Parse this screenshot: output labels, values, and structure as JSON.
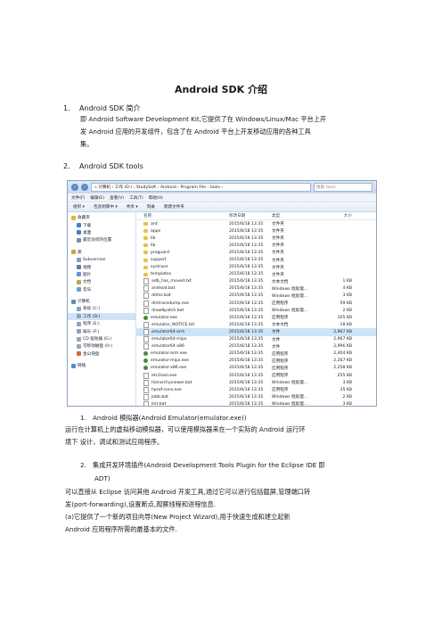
{
  "doc": {
    "title": "Android SDK 介绍",
    "s1_num": "1.",
    "s1_title": "Android SDK 简介",
    "s1_line1": "即 Android Software Development Kit,它提供了在 Windows/Linux/Mac 平台上开",
    "s1_line2": "发 Android 应用的开发组件，包含了在 Android 平台上开发移动应用的各种工具",
    "s1_line3": "集。",
    "s2_num": "2.",
    "s2_title": "Android SDK tools",
    "sub1_num": "1.",
    "sub1_title": "Android 模拟器(Android Emulator(emulator.exe))",
    "p1_line1": "运行在计算机上的虚拟移动模拟器，可以使用模拟器来在一个实际的 Android 运行环",
    "p1_line2": "境下 设计，调试和测试应用程序。",
    "sub2_num": "2.",
    "sub2_title": "集成开发环境插件(Android Development Tools Plugin for the Eclipse IDE  即",
    "sub2_title2": "ADT)",
    "p2_line1": "可以直接从 Eclipse 访问其他 Android 开发工具,通过它可以进行包括截屏,管理端口转",
    "p2_line2": "发(port-forwarding),设置断点,观察线程和进程信息.",
    "p2_line3": "(a)它提供了一个新的项目向导(New Project Wizard),用于快速生成和建立起新",
    "p2_line4": "Android 应用程序所需的最基本的文件."
  },
  "explorer": {
    "address": "« 计算机 › 工作 (D:) › StudySoft › Android › Program File › tools ›",
    "search_placeholder": "搜索 tools",
    "menu": [
      "文件(F)",
      "编辑(E)",
      "查看(V)",
      "工具(T)",
      "帮助(H)"
    ],
    "toolbar": [
      "组织 ▾",
      "包含到库中 ▾",
      "共享 ▾",
      "刻录",
      "新建文件夹"
    ],
    "nav": [
      {
        "label": "收藏夹",
        "child": false,
        "color": "#e2b33a"
      },
      {
        "label": "下载",
        "child": true,
        "color": "#4a7fc1"
      },
      {
        "label": "桌面",
        "child": true,
        "color": "#4a7fc1"
      },
      {
        "label": "最近访问的位置",
        "child": true,
        "color": "#7a8fa8"
      },
      {
        "gap": true
      },
      {
        "label": "库",
        "child": false,
        "color": "#c8a24a"
      },
      {
        "label": "Subversion",
        "child": true,
        "color": "#8b9bb0"
      },
      {
        "label": "视频",
        "child": true,
        "color": "#5b7fb0"
      },
      {
        "label": "图片",
        "child": true,
        "color": "#5b9ad0"
      },
      {
        "label": "文档",
        "child": true,
        "color": "#c8a24a"
      },
      {
        "label": "音乐",
        "child": true,
        "color": "#6aa0d8"
      },
      {
        "gap": true
      },
      {
        "label": "计算机",
        "child": false,
        "color": "#6c8bb0"
      },
      {
        "label": "系统 (C:)",
        "child": true,
        "color": "#8da3be"
      },
      {
        "label": "工作 (D:)",
        "child": true,
        "color": "#8da3be",
        "selected": true
      },
      {
        "label": "程序 (E:)",
        "child": true,
        "color": "#8da3be"
      },
      {
        "label": "娱乐 (F:)",
        "child": true,
        "color": "#8da3be"
      },
      {
        "label": "CD 驱动器 (G:)",
        "child": true,
        "color": "#9aa6b4"
      },
      {
        "label": "可移动磁盘 (H:)",
        "child": true,
        "color": "#9aa6b4"
      },
      {
        "label": "金山快盘",
        "child": true,
        "color": "#d06a3a"
      },
      {
        "gap": true
      },
      {
        "label": "网络",
        "child": false,
        "color": "#5a8bc8"
      }
    ],
    "headers": {
      "name": "名称",
      "date": "修改日期",
      "type": "类型",
      "size": "大小"
    },
    "files": [
      {
        "name": "ant",
        "date": "2015/6/18 13:35",
        "type": "文件夹",
        "size": "",
        "icon": "folder"
      },
      {
        "name": "apps",
        "date": "2015/6/18 13:35",
        "type": "文件夹",
        "size": "",
        "icon": "folder"
      },
      {
        "name": "lib",
        "date": "2015/6/18 13:35",
        "type": "文件夹",
        "size": "",
        "icon": "folder"
      },
      {
        "name": "lib",
        "date": "2015/6/18 13:35",
        "type": "文件夹",
        "size": "",
        "icon": "folder"
      },
      {
        "name": "proguard",
        "date": "2015/6/18 13:35",
        "type": "文件夹",
        "size": "",
        "icon": "folder"
      },
      {
        "name": "support",
        "date": "2015/6/18 13:35",
        "type": "文件夹",
        "size": "",
        "icon": "folder"
      },
      {
        "name": "systrace",
        "date": "2015/6/18 13:35",
        "type": "文件夹",
        "size": "",
        "icon": "folder"
      },
      {
        "name": "templates",
        "date": "2015/6/18 13:35",
        "type": "文件夹",
        "size": "",
        "icon": "folder"
      },
      {
        "name": "adb_has_moved.txt",
        "date": "2015/6/18 13:35",
        "type": "文本文档",
        "size": "1 KB",
        "icon": "file"
      },
      {
        "name": "android.bat",
        "date": "2015/6/18 13:35",
        "type": "Windows 批处理...",
        "size": "4 KB",
        "icon": "file"
      },
      {
        "name": "ddms.bat",
        "date": "2015/6/18 13:35",
        "type": "Windows 批处理...",
        "size": "3 KB",
        "icon": "file"
      },
      {
        "name": "dmtracedump.exe",
        "date": "2015/6/18 13:35",
        "type": "应用程序",
        "size": "59 KB",
        "icon": "file"
      },
      {
        "name": "draw9patch.bat",
        "date": "2015/6/18 13:35",
        "type": "Windows 批处理...",
        "size": "2 KB",
        "icon": "file"
      },
      {
        "name": "emulator.exe",
        "date": "2015/6/18 13:35",
        "type": "应用程序",
        "size": "105 KB",
        "icon": "exe"
      },
      {
        "name": "emulator_NOTICE.txt",
        "date": "2015/6/18 13:35",
        "type": "文本文档",
        "size": "18 KB",
        "icon": "file"
      },
      {
        "name": "emulator64-arm",
        "date": "2015/6/18 13:35",
        "type": "文件",
        "size": "2,967 KB",
        "icon": "file",
        "highlight": true
      },
      {
        "name": "emulator64-mips",
        "date": "2015/6/18 13:35",
        "type": "文件",
        "size": "2,967 KB",
        "icon": "file"
      },
      {
        "name": "emulator64-x86",
        "date": "2015/6/18 13:35",
        "type": "文件",
        "size": "2,996 KB",
        "icon": "file"
      },
      {
        "name": "emulator-arm.exe",
        "date": "2015/6/18 13:35",
        "type": "应用程序",
        "size": "2,404 KB",
        "icon": "exe"
      },
      {
        "name": "emulator-mips.exe",
        "date": "2015/6/18 13:35",
        "type": "应用程序",
        "size": "2,267 KB",
        "icon": "exe"
      },
      {
        "name": "emulator-x86.exe",
        "date": "2015/6/18 13:35",
        "type": "应用程序",
        "size": "2,258 KB",
        "icon": "exe"
      },
      {
        "name": "etc1tool.exe",
        "date": "2015/6/18 13:35",
        "type": "应用程序",
        "size": "255 KB",
        "icon": "file"
      },
      {
        "name": "hierarchyviewer.bat",
        "date": "2015/6/18 13:35",
        "type": "Windows 批处理...",
        "size": "3 KB",
        "icon": "file"
      },
      {
        "name": "hprof-conv.exe",
        "date": "2015/6/18 13:35",
        "type": "应用程序",
        "size": "35 KB",
        "icon": "file"
      },
      {
        "name": "jobb.bat",
        "date": "2015/6/18 13:35",
        "type": "Windows 批处理...",
        "size": "2 KB",
        "icon": "file"
      },
      {
        "name": "lint.bat",
        "date": "2015/6/18 13:35",
        "type": "Windows 批处理...",
        "size": "3 KB",
        "icon": "file"
      }
    ]
  }
}
